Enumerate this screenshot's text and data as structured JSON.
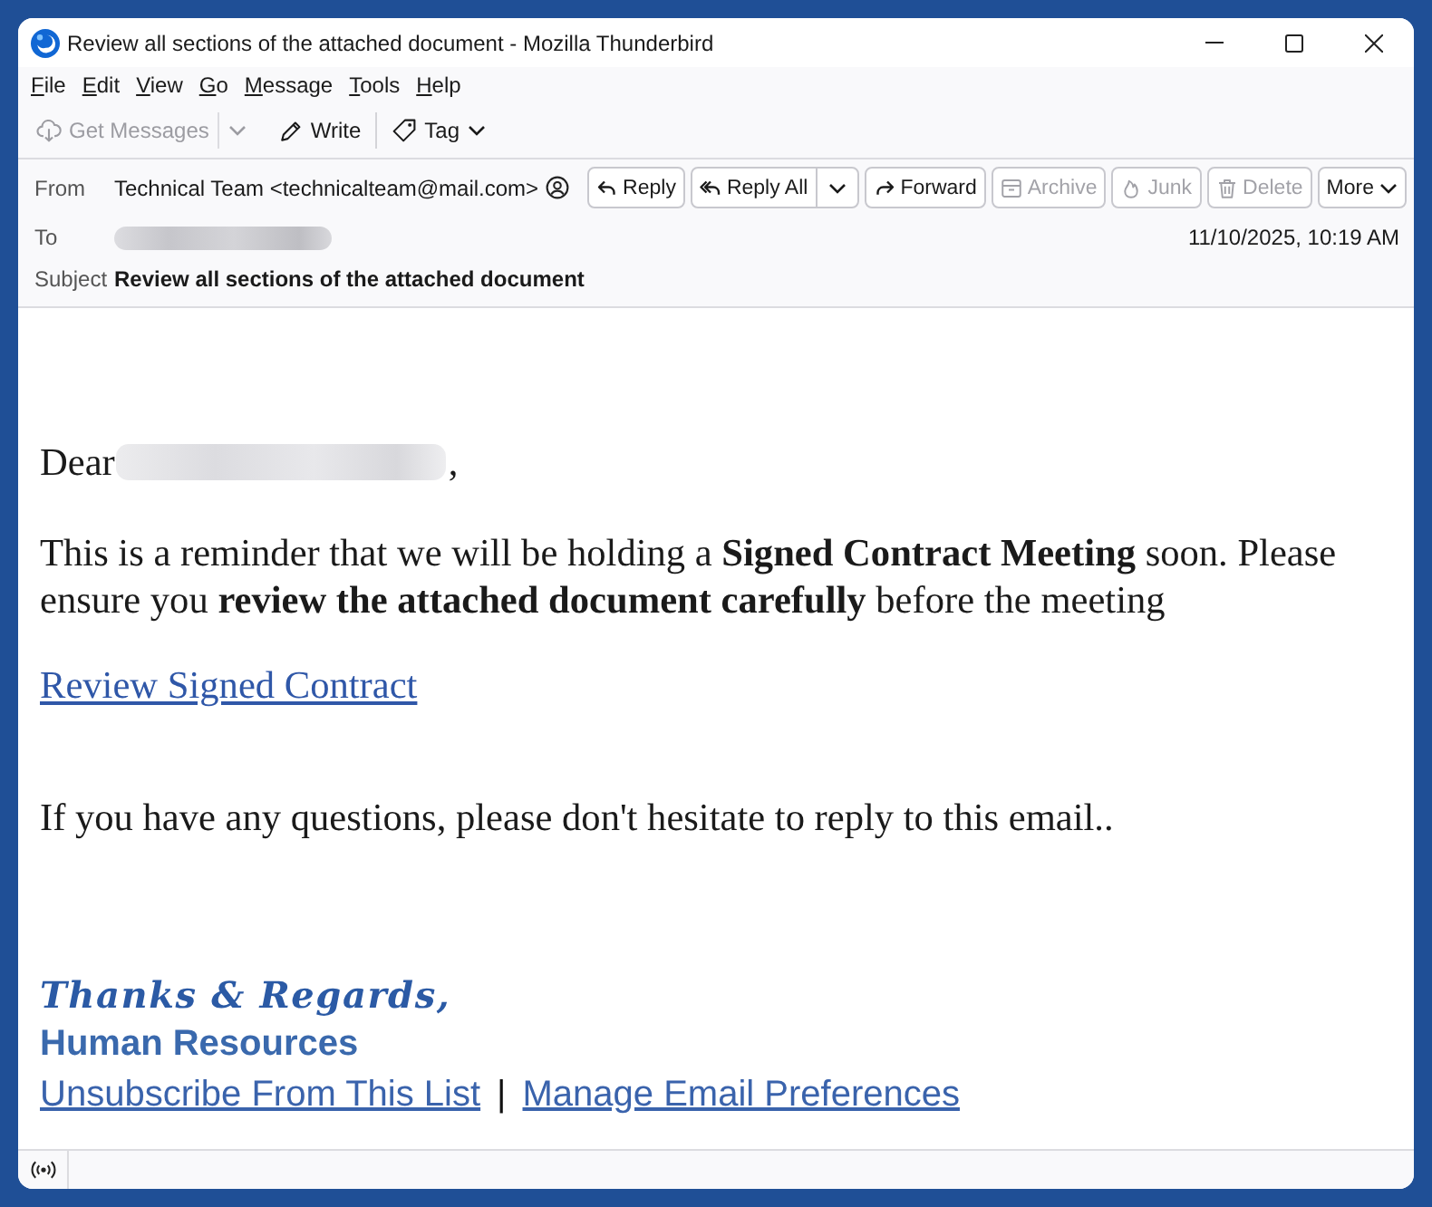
{
  "window": {
    "title": "Review all sections of the attached document - Mozilla Thunderbird"
  },
  "menu_bar": [
    "File",
    "Edit",
    "View",
    "Go",
    "Message",
    "Tools",
    "Help"
  ],
  "toolbar": [
    {
      "kind": "fetch",
      "label": "Get Messages",
      "disabled": true
    },
    {
      "kind": "dropdown",
      "disabled": true
    },
    {
      "kind": "compose",
      "label": "Write",
      "disabled": false
    },
    {
      "kind": "separator"
    },
    {
      "kind": "tag",
      "label": "Tag",
      "disabled": false
    }
  ],
  "header": {
    "from": {
      "label": "From",
      "value": "Technical Team <technicalteam@mail.com>"
    },
    "to": {
      "label": "To",
      "redacted": true
    },
    "date": "11/10/2025, 10:19 AM",
    "subject": {
      "label": "Subject",
      "value": "Review all sections of the attached document"
    },
    "actions": [
      {
        "kind": "reply",
        "label": "Reply",
        "split": false,
        "disabled": false
      },
      {
        "kind": "replyall",
        "label": "Reply All",
        "split": true,
        "disabled": false
      },
      {
        "kind": "forward",
        "label": "Forward",
        "split": false,
        "disabled": false
      },
      {
        "kind": "archive",
        "label": "Archive",
        "split": false,
        "disabled": true
      },
      {
        "kind": "junk",
        "label": "Junk",
        "split": false,
        "disabled": true
      },
      {
        "kind": "delete",
        "label": "Delete",
        "split": false,
        "disabled": true
      },
      {
        "kind": "more",
        "label": "More",
        "split": false,
        "disabled": false
      }
    ]
  },
  "body": [
    {
      "kind": "greeting",
      "text": "Dear",
      "redacted": true,
      "after": ","
    },
    {
      "kind": "paragraph",
      "text": "This is a reminder that we will be holding a **Signed Contract Meeting** soon. Please ensure you **review the attached document carefully** before the meeting"
    },
    {
      "kind": "link",
      "text": "Review Signed Contract"
    },
    {
      "kind": "paragraph",
      "text": "If you have any questions, please don't hesitate to reply to this email.."
    }
  ],
  "signature": {
    "closing": "Thanks & Regards,",
    "name": "Human Resources",
    "links": [
      "Unsubscribe From This List",
      "Manage Email Preferences"
    ],
    "separator": "|"
  }
}
